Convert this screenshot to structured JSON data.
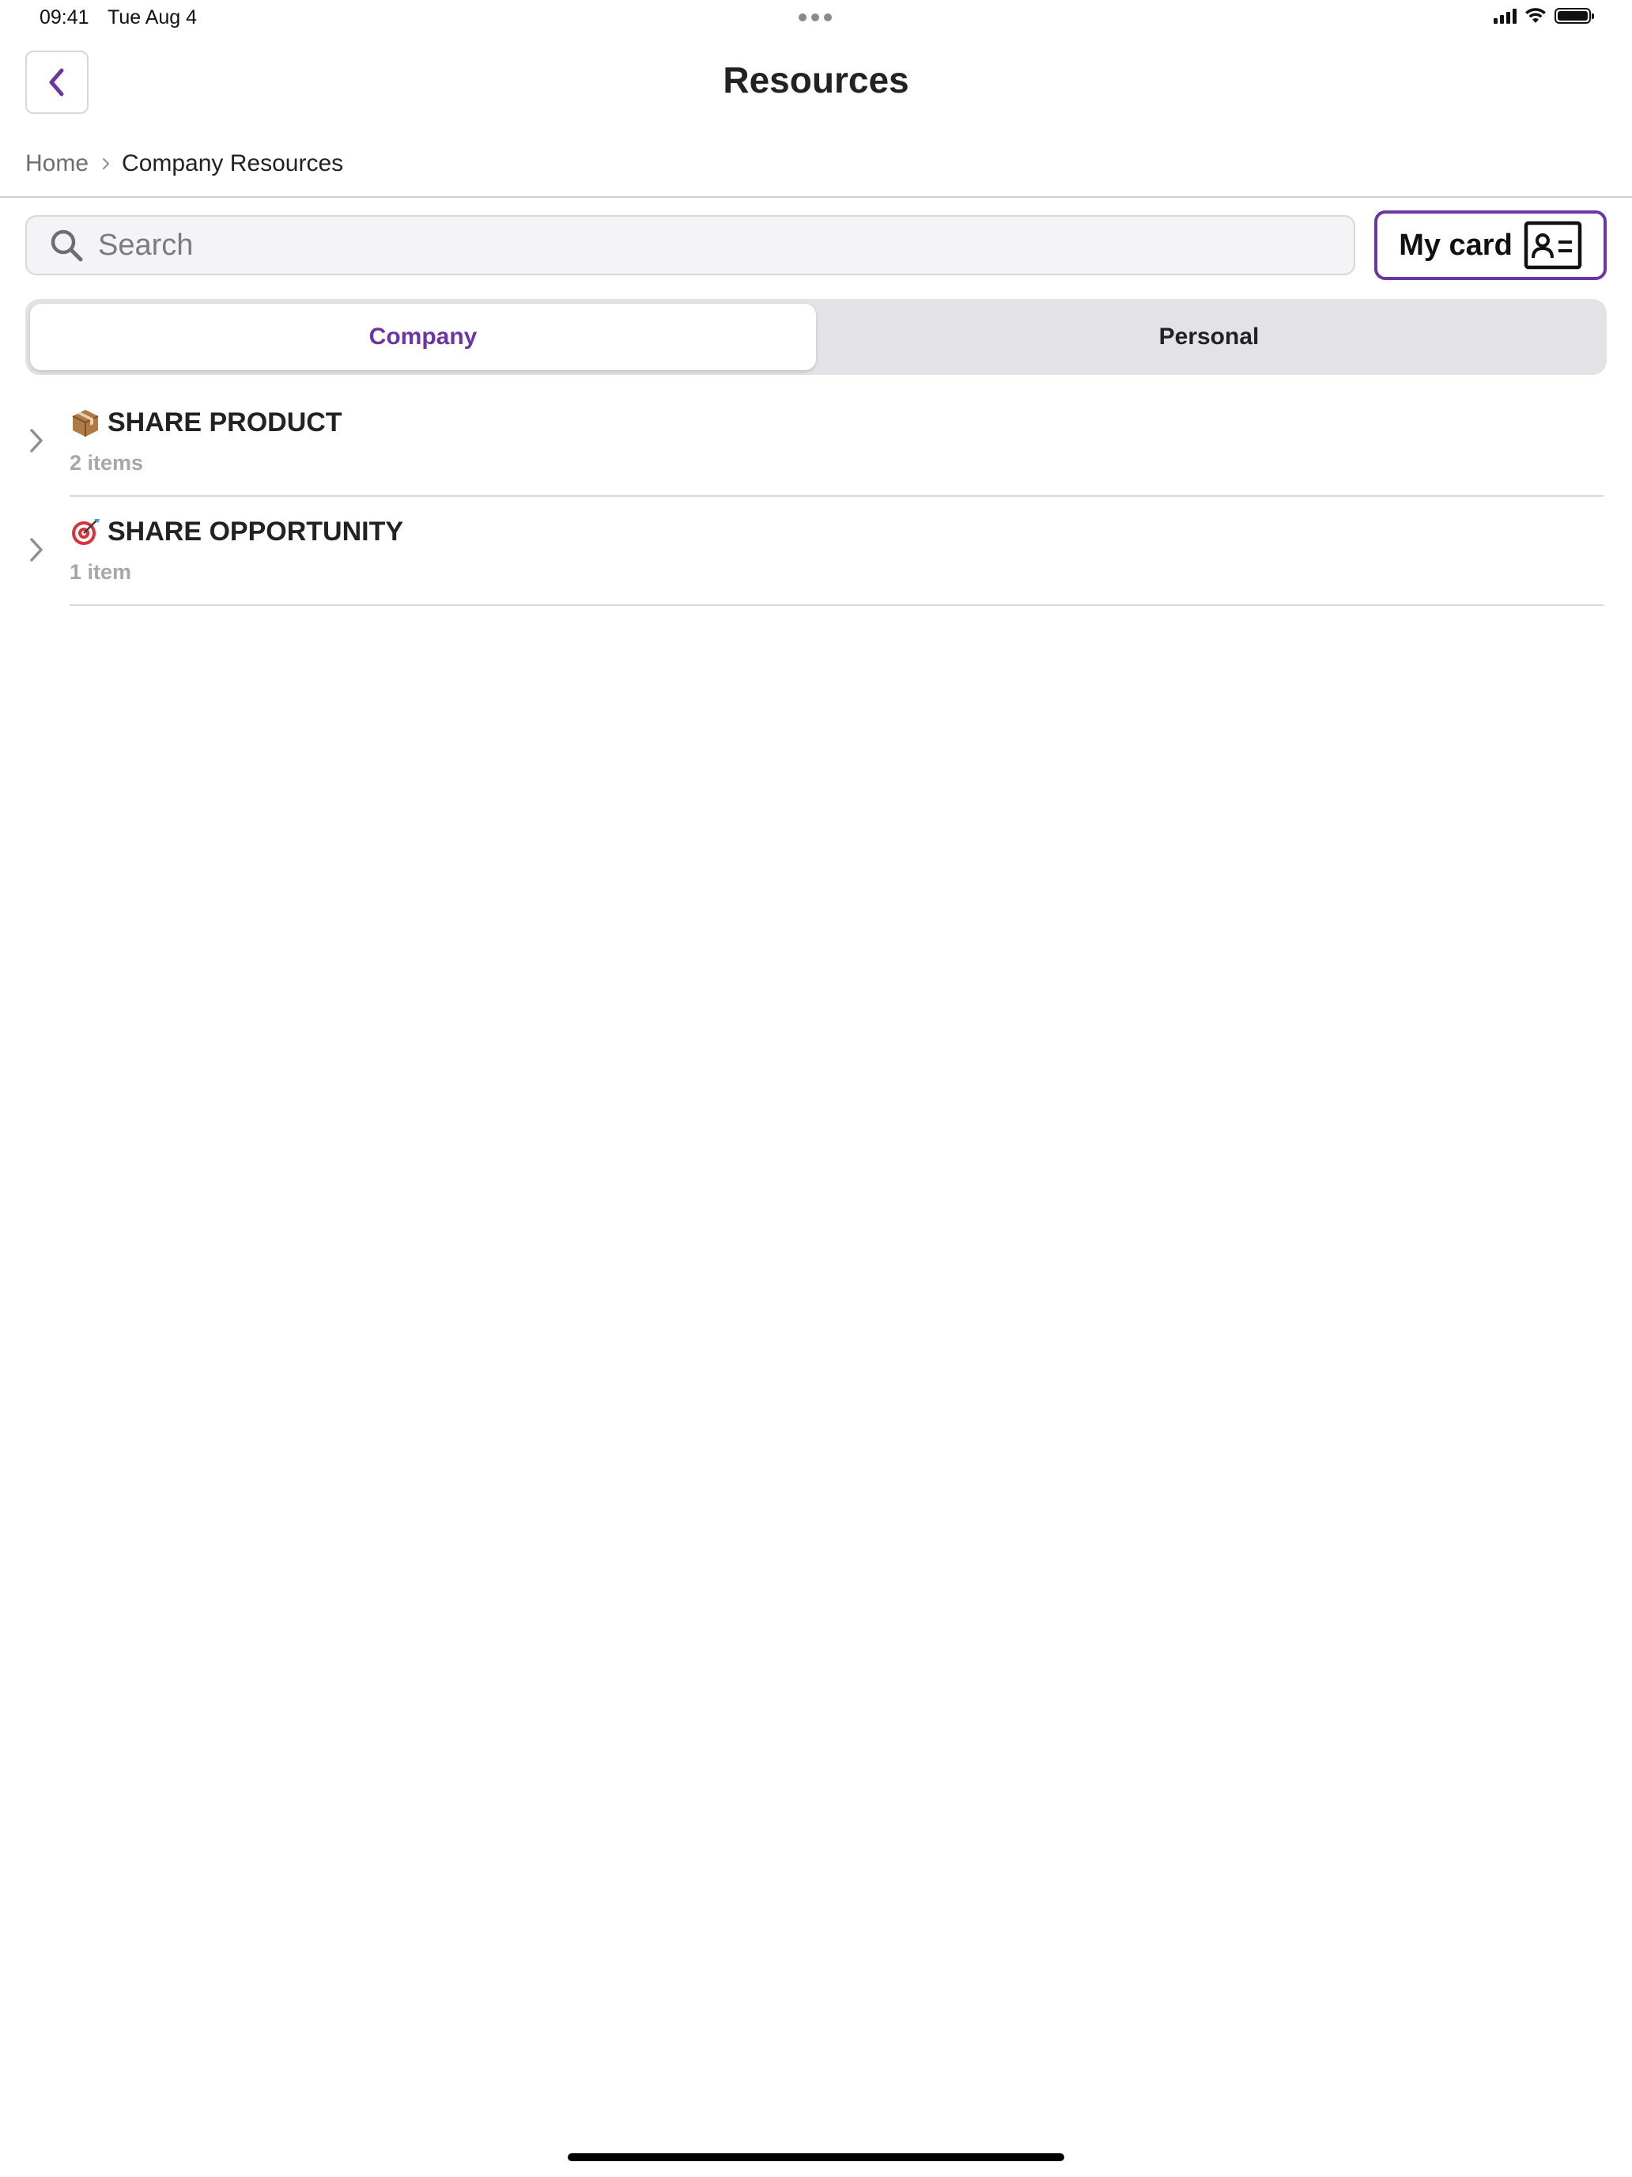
{
  "status_bar": {
    "time": "09:41",
    "date": "Tue Aug 4"
  },
  "header": {
    "title": "Resources",
    "back_icon": "chevron-left-icon"
  },
  "breadcrumb": {
    "items": [
      "Home",
      "Company Resources"
    ]
  },
  "search": {
    "placeholder": "Search",
    "value": ""
  },
  "my_card": {
    "label": "My card",
    "icon": "contact-card-icon"
  },
  "tabs": [
    {
      "label": "Company",
      "active": true
    },
    {
      "label": "Personal",
      "active": false
    }
  ],
  "resources": [
    {
      "title": "SHARE PRODUCT",
      "count": "2 items",
      "icon": "package-icon"
    },
    {
      "title": "SHARE OPPORTUNITY",
      "count": "1 item",
      "icon": "target-icon"
    }
  ],
  "colors": {
    "accent": "#6b35a3",
    "text": "#222222",
    "muted": "#a7a7ab",
    "segment_bg": "#e2e2e7"
  }
}
